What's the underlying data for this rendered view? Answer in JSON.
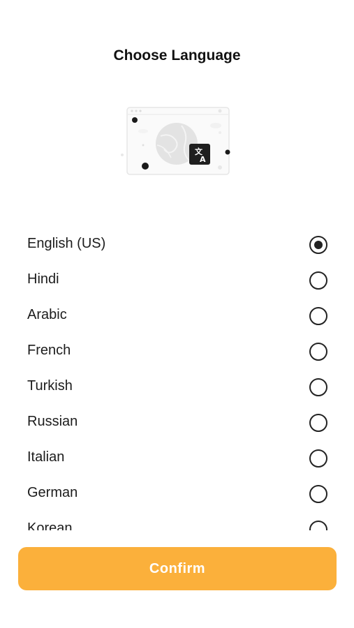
{
  "header": {
    "title": "Choose Language"
  },
  "languages": [
    {
      "label": "English (US)",
      "selected": true
    },
    {
      "label": "Hindi",
      "selected": false
    },
    {
      "label": "Arabic",
      "selected": false
    },
    {
      "label": "French",
      "selected": false
    },
    {
      "label": "Turkish",
      "selected": false
    },
    {
      "label": "Russian",
      "selected": false
    },
    {
      "label": "Italian",
      "selected": false
    },
    {
      "label": "German",
      "selected": false
    },
    {
      "label": "Korean",
      "selected": false
    }
  ],
  "footer": {
    "confirm_label": "Confirm"
  },
  "colors": {
    "accent": "#fbb03b",
    "text": "#1c1c1c",
    "radio": "#222222"
  },
  "icons": {
    "illustration": "translate-globe-illustration"
  }
}
